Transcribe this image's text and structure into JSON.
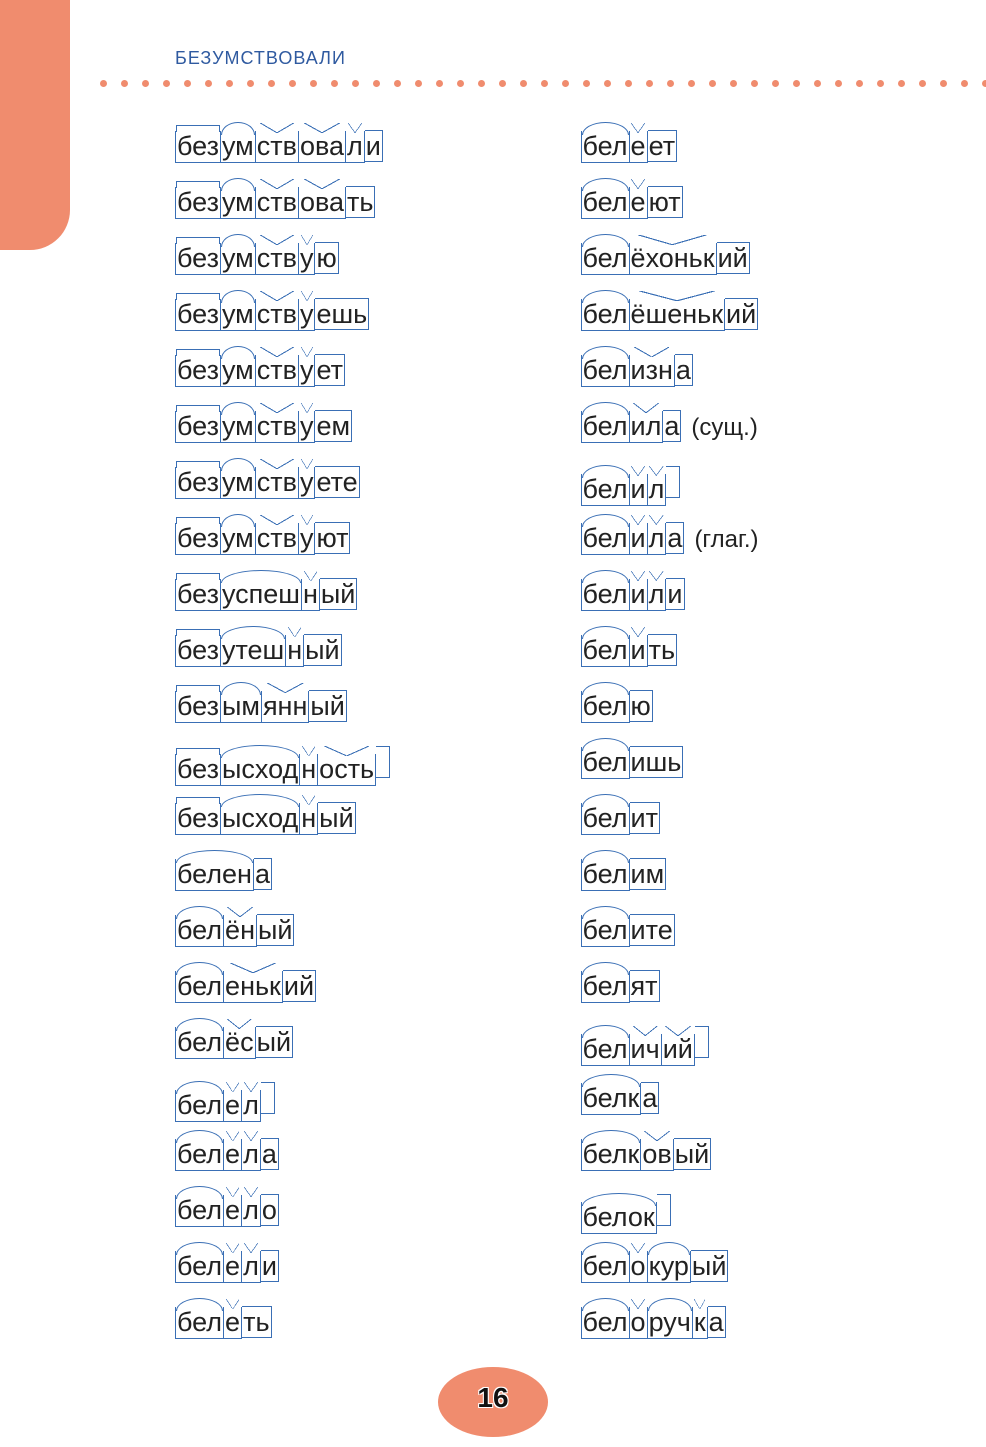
{
  "header": "БЕЗУМСТВОВАЛИ",
  "page_number": "16",
  "columns": [
    [
      {
        "segments": [
          {
            "t": "без",
            "k": "prefix"
          },
          {
            "t": "ум",
            "k": "root"
          },
          {
            "t": "ств",
            "k": "suffix"
          },
          {
            "t": "ова",
            "k": "suffix"
          },
          {
            "t": "л",
            "k": "suffix"
          },
          {
            "t": "и",
            "k": "ending"
          }
        ]
      },
      {
        "segments": [
          {
            "t": "без",
            "k": "prefix"
          },
          {
            "t": "ум",
            "k": "root"
          },
          {
            "t": "ств",
            "k": "suffix"
          },
          {
            "t": "ова",
            "k": "suffix"
          },
          {
            "t": "ть",
            "k": "ending"
          }
        ]
      },
      {
        "segments": [
          {
            "t": "без",
            "k": "prefix"
          },
          {
            "t": "ум",
            "k": "root"
          },
          {
            "t": "ств",
            "k": "suffix"
          },
          {
            "t": "у",
            "k": "suffix"
          },
          {
            "t": "ю",
            "k": "ending"
          }
        ]
      },
      {
        "segments": [
          {
            "t": "без",
            "k": "prefix"
          },
          {
            "t": "ум",
            "k": "root"
          },
          {
            "t": "ств",
            "k": "suffix"
          },
          {
            "t": "у",
            "k": "suffix"
          },
          {
            "t": "ешь",
            "k": "ending"
          }
        ]
      },
      {
        "segments": [
          {
            "t": "без",
            "k": "prefix"
          },
          {
            "t": "ум",
            "k": "root"
          },
          {
            "t": "ств",
            "k": "suffix"
          },
          {
            "t": "у",
            "k": "suffix"
          },
          {
            "t": "ет",
            "k": "ending"
          }
        ]
      },
      {
        "segments": [
          {
            "t": "без",
            "k": "prefix"
          },
          {
            "t": "ум",
            "k": "root"
          },
          {
            "t": "ств",
            "k": "suffix"
          },
          {
            "t": "у",
            "k": "suffix"
          },
          {
            "t": "ем",
            "k": "ending"
          }
        ]
      },
      {
        "segments": [
          {
            "t": "без",
            "k": "prefix"
          },
          {
            "t": "ум",
            "k": "root"
          },
          {
            "t": "ств",
            "k": "suffix"
          },
          {
            "t": "у",
            "k": "suffix"
          },
          {
            "t": "ете",
            "k": "ending"
          }
        ]
      },
      {
        "segments": [
          {
            "t": "без",
            "k": "prefix"
          },
          {
            "t": "ум",
            "k": "root"
          },
          {
            "t": "ств",
            "k": "suffix"
          },
          {
            "t": "у",
            "k": "suffix"
          },
          {
            "t": "ют",
            "k": "ending"
          }
        ]
      },
      {
        "segments": [
          {
            "t": "без",
            "k": "prefix"
          },
          {
            "t": "успеш",
            "k": "root"
          },
          {
            "t": "н",
            "k": "suffix"
          },
          {
            "t": "ый",
            "k": "ending"
          }
        ]
      },
      {
        "segments": [
          {
            "t": "без",
            "k": "prefix"
          },
          {
            "t": "утеш",
            "k": "root"
          },
          {
            "t": "н",
            "k": "suffix"
          },
          {
            "t": "ый",
            "k": "ending"
          }
        ]
      },
      {
        "segments": [
          {
            "t": "без",
            "k": "prefix"
          },
          {
            "t": "ым",
            "k": "root"
          },
          {
            "t": "янн",
            "k": "suffix"
          },
          {
            "t": "ый",
            "k": "ending"
          }
        ]
      },
      {
        "segments": [
          {
            "t": "без",
            "k": "prefix"
          },
          {
            "t": "ысход",
            "k": "root"
          },
          {
            "t": "н",
            "k": "suffix"
          },
          {
            "t": "ость",
            "k": "suffix"
          },
          {
            "t": "",
            "k": "null"
          }
        ]
      },
      {
        "segments": [
          {
            "t": "без",
            "k": "prefix"
          },
          {
            "t": "ысход",
            "k": "root"
          },
          {
            "t": "н",
            "k": "suffix"
          },
          {
            "t": "ый",
            "k": "ending"
          }
        ]
      },
      {
        "segments": [
          {
            "t": "белен",
            "k": "root"
          },
          {
            "t": "а",
            "k": "ending"
          }
        ]
      },
      {
        "segments": [
          {
            "t": "бел",
            "k": "root"
          },
          {
            "t": "ён",
            "k": "suffix"
          },
          {
            "t": "ый",
            "k": "ending"
          }
        ]
      },
      {
        "segments": [
          {
            "t": "бел",
            "k": "root"
          },
          {
            "t": "еньк",
            "k": "suffix"
          },
          {
            "t": "ий",
            "k": "ending"
          }
        ]
      },
      {
        "segments": [
          {
            "t": "бел",
            "k": "root"
          },
          {
            "t": "ёс",
            "k": "suffix"
          },
          {
            "t": "ый",
            "k": "ending"
          }
        ]
      },
      {
        "segments": [
          {
            "t": "бел",
            "k": "root"
          },
          {
            "t": "е",
            "k": "suffix"
          },
          {
            "t": "л",
            "k": "suffix"
          },
          {
            "t": "",
            "k": "null"
          }
        ]
      },
      {
        "segments": [
          {
            "t": "бел",
            "k": "root"
          },
          {
            "t": "е",
            "k": "suffix"
          },
          {
            "t": "л",
            "k": "suffix"
          },
          {
            "t": "а",
            "k": "ending"
          }
        ]
      },
      {
        "segments": [
          {
            "t": "бел",
            "k": "root"
          },
          {
            "t": "е",
            "k": "suffix"
          },
          {
            "t": "л",
            "k": "suffix"
          },
          {
            "t": "о",
            "k": "ending"
          }
        ]
      },
      {
        "segments": [
          {
            "t": "бел",
            "k": "root"
          },
          {
            "t": "е",
            "k": "suffix"
          },
          {
            "t": "л",
            "k": "suffix"
          },
          {
            "t": "и",
            "k": "ending"
          }
        ]
      },
      {
        "segments": [
          {
            "t": "бел",
            "k": "root"
          },
          {
            "t": "е",
            "k": "suffix"
          },
          {
            "t": "ть",
            "k": "ending"
          }
        ]
      }
    ],
    [
      {
        "segments": [
          {
            "t": "бел",
            "k": "root"
          },
          {
            "t": "е",
            "k": "suffix"
          },
          {
            "t": "ет",
            "k": "ending"
          }
        ]
      },
      {
        "segments": [
          {
            "t": "бел",
            "k": "root"
          },
          {
            "t": "е",
            "k": "suffix"
          },
          {
            "t": "ют",
            "k": "ending"
          }
        ]
      },
      {
        "segments": [
          {
            "t": "бел",
            "k": "root"
          },
          {
            "t": "ёхоньк",
            "k": "suffix"
          },
          {
            "t": "ий",
            "k": "ending"
          }
        ]
      },
      {
        "segments": [
          {
            "t": "бел",
            "k": "root"
          },
          {
            "t": "ёшеньк",
            "k": "suffix"
          },
          {
            "t": "ий",
            "k": "ending"
          }
        ]
      },
      {
        "segments": [
          {
            "t": "бел",
            "k": "root"
          },
          {
            "t": "изн",
            "k": "suffix"
          },
          {
            "t": "а",
            "k": "ending"
          }
        ]
      },
      {
        "segments": [
          {
            "t": "бел",
            "k": "root"
          },
          {
            "t": "ил",
            "k": "suffix"
          },
          {
            "t": "а",
            "k": "ending"
          }
        ],
        "annot": "(сущ.)"
      },
      {
        "segments": [
          {
            "t": "бел",
            "k": "root"
          },
          {
            "t": "и",
            "k": "suffix"
          },
          {
            "t": "л",
            "k": "suffix"
          },
          {
            "t": "",
            "k": "null"
          }
        ]
      },
      {
        "segments": [
          {
            "t": "бел",
            "k": "root"
          },
          {
            "t": "и",
            "k": "suffix"
          },
          {
            "t": "л",
            "k": "suffix"
          },
          {
            "t": "а",
            "k": "ending"
          }
        ],
        "annot": "(глаг.)"
      },
      {
        "segments": [
          {
            "t": "бел",
            "k": "root"
          },
          {
            "t": "и",
            "k": "suffix"
          },
          {
            "t": "л",
            "k": "suffix"
          },
          {
            "t": "и",
            "k": "ending"
          }
        ]
      },
      {
        "segments": [
          {
            "t": "бел",
            "k": "root"
          },
          {
            "t": "и",
            "k": "suffix"
          },
          {
            "t": "ть",
            "k": "ending"
          }
        ]
      },
      {
        "segments": [
          {
            "t": "бел",
            "k": "root"
          },
          {
            "t": "ю",
            "k": "ending"
          }
        ]
      },
      {
        "segments": [
          {
            "t": "бел",
            "k": "root"
          },
          {
            "t": "ишь",
            "k": "ending"
          }
        ]
      },
      {
        "segments": [
          {
            "t": "бел",
            "k": "root"
          },
          {
            "t": "ит",
            "k": "ending"
          }
        ]
      },
      {
        "segments": [
          {
            "t": "бел",
            "k": "root"
          },
          {
            "t": "им",
            "k": "ending"
          }
        ]
      },
      {
        "segments": [
          {
            "t": "бел",
            "k": "root"
          },
          {
            "t": "ите",
            "k": "ending"
          }
        ]
      },
      {
        "segments": [
          {
            "t": "бел",
            "k": "root"
          },
          {
            "t": "ят",
            "k": "ending"
          }
        ]
      },
      {
        "segments": [
          {
            "t": "бел",
            "k": "root"
          },
          {
            "t": "ич",
            "k": "suffix"
          },
          {
            "t": "ий",
            "k": "suffix"
          },
          {
            "t": "",
            "k": "null"
          }
        ]
      },
      {
        "segments": [
          {
            "t": "белк",
            "k": "root"
          },
          {
            "t": "а",
            "k": "ending"
          }
        ]
      },
      {
        "segments": [
          {
            "t": "белк",
            "k": "root"
          },
          {
            "t": "ов",
            "k": "suffix"
          },
          {
            "t": "ый",
            "k": "ending"
          }
        ]
      },
      {
        "segments": [
          {
            "t": "белок",
            "k": "root"
          },
          {
            "t": "",
            "k": "null"
          }
        ]
      },
      {
        "segments": [
          {
            "t": "бел",
            "k": "root"
          },
          {
            "t": "о",
            "k": "suffix"
          },
          {
            "t": "кур",
            "k": "root"
          },
          {
            "t": "ый",
            "k": "ending"
          }
        ]
      },
      {
        "segments": [
          {
            "t": "бел",
            "k": "root"
          },
          {
            "t": "о",
            "k": "suffix"
          },
          {
            "t": "руч",
            "k": "root"
          },
          {
            "t": "к",
            "k": "suffix"
          },
          {
            "t": "а",
            "k": "ending"
          }
        ]
      }
    ]
  ]
}
